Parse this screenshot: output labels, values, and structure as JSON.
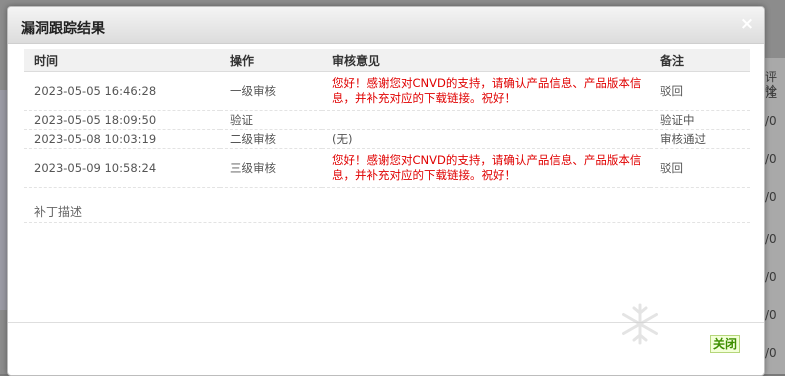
{
  "dialog": {
    "title": "漏洞跟踪结果",
    "close_icon": "×"
  },
  "table": {
    "headers": [
      "时间",
      "操作",
      "审核意见",
      "备注"
    ],
    "rows": [
      {
        "time": "2023-05-05 16:46:28",
        "action": "一级审核",
        "opinion": "您好！感谢您对CNVD的支持，请确认产品信息、产品版本信息，并补充对应的下载链接。祝好！",
        "remark": "驳回"
      },
      {
        "time": "2023-05-05 18:09:50",
        "action": "验证",
        "opinion": "",
        "remark": "验证中"
      },
      {
        "time": "2023-05-08 10:03:19",
        "action": "二级审核",
        "opinion": "(无)",
        "remark": "审核通过"
      },
      {
        "time": "2023-05-09 10:58:24",
        "action": "三级审核",
        "opinion": "您好！感谢您对CNVD的支持，请确认产品信息、产品版本信息，并补充对应的下载链接。祝好！",
        "remark": "驳回"
      }
    ]
  },
  "patch_label": "补丁描述",
  "footer": {
    "close_label": "关闭"
  },
  "background": {
    "right_texts": [
      "评论",
      "注",
      "/0",
      "/0",
      "/0",
      "/0",
      "/0",
      "/0",
      "/0"
    ]
  },
  "colors": {
    "alert_red": "#e00000",
    "close_green": "#3d8e00"
  }
}
